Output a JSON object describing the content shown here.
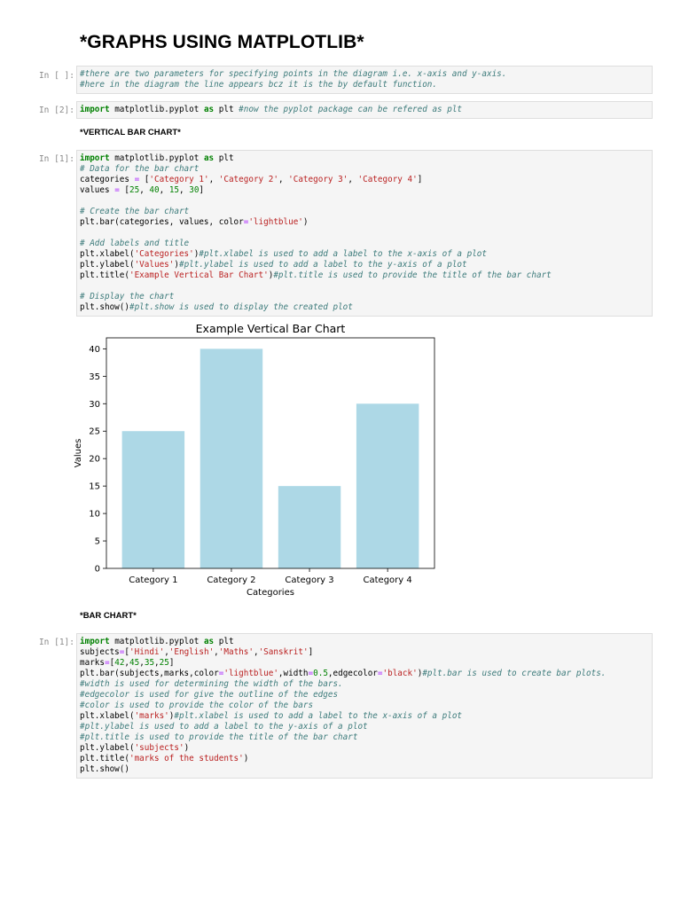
{
  "page": {
    "title": "*GRAPHS USING MATPLOTLIB*"
  },
  "cells": {
    "c1": {
      "prompt": "In [ ]:",
      "lines": [
        [
          {
            "t": "#there are two parameters for specifying points in the diagram i.e. x-axis and y-axis.",
            "c": "cm"
          }
        ],
        [
          {
            "t": "#here in the diagram the line appears bcz it is the by default function.",
            "c": "cm"
          }
        ]
      ]
    },
    "c2": {
      "prompt": "In [2]:",
      "lines": [
        [
          {
            "t": "import",
            "c": "kw"
          },
          {
            "t": " matplotlib.pyplot ",
            "c": ""
          },
          {
            "t": "as",
            "c": "kw"
          },
          {
            "t": " plt ",
            "c": ""
          },
          {
            "t": "#now the pyplot package can be refered as plt",
            "c": "cm"
          }
        ]
      ]
    },
    "md1": {
      "text": "*VERTICAL BAR CHART*"
    },
    "c3": {
      "prompt": "In [1]:",
      "lines": [
        [
          {
            "t": "import",
            "c": "kw"
          },
          {
            "t": " matplotlib.pyplot ",
            "c": ""
          },
          {
            "t": "as",
            "c": "kw"
          },
          {
            "t": " plt",
            "c": ""
          }
        ],
        [
          {
            "t": "# Data for the bar chart",
            "c": "cm"
          }
        ],
        [
          {
            "t": "categories ",
            "c": ""
          },
          {
            "t": "=",
            "c": "op"
          },
          {
            "t": " [",
            "c": ""
          },
          {
            "t": "'Category 1'",
            "c": "str"
          },
          {
            "t": ", ",
            "c": ""
          },
          {
            "t": "'Category 2'",
            "c": "str"
          },
          {
            "t": ", ",
            "c": ""
          },
          {
            "t": "'Category 3'",
            "c": "str"
          },
          {
            "t": ", ",
            "c": ""
          },
          {
            "t": "'Category 4'",
            "c": "str"
          },
          {
            "t": "]",
            "c": ""
          }
        ],
        [
          {
            "t": "values ",
            "c": ""
          },
          {
            "t": "=",
            "c": "op"
          },
          {
            "t": " [",
            "c": ""
          },
          {
            "t": "25",
            "c": "num"
          },
          {
            "t": ", ",
            "c": ""
          },
          {
            "t": "40",
            "c": "num"
          },
          {
            "t": ", ",
            "c": ""
          },
          {
            "t": "15",
            "c": "num"
          },
          {
            "t": ", ",
            "c": ""
          },
          {
            "t": "30",
            "c": "num"
          },
          {
            "t": "]",
            "c": ""
          }
        ],
        [],
        [
          {
            "t": "# Create the bar chart",
            "c": "cm"
          }
        ],
        [
          {
            "t": "plt.bar(categories, values, color",
            "c": ""
          },
          {
            "t": "=",
            "c": "op"
          },
          {
            "t": "'lightblue'",
            "c": "str"
          },
          {
            "t": ")",
            "c": ""
          }
        ],
        [],
        [
          {
            "t": "# Add labels and title",
            "c": "cm"
          }
        ],
        [
          {
            "t": "plt.xlabel(",
            "c": ""
          },
          {
            "t": "'Categories'",
            "c": "str"
          },
          {
            "t": ")",
            "c": ""
          },
          {
            "t": "#plt.xlabel is used to add a label to the x-axis of a plot",
            "c": "cm"
          }
        ],
        [
          {
            "t": "plt.ylabel(",
            "c": ""
          },
          {
            "t": "'Values'",
            "c": "str"
          },
          {
            "t": ")",
            "c": ""
          },
          {
            "t": "#plt.ylabel is used to add a label to the y-axis of a plot",
            "c": "cm"
          }
        ],
        [
          {
            "t": "plt.title(",
            "c": ""
          },
          {
            "t": "'Example Vertical Bar Chart'",
            "c": "str"
          },
          {
            "t": ")",
            "c": ""
          },
          {
            "t": "#plt.title is used to provide the title of the bar chart",
            "c": "cm"
          }
        ],
        [],
        [
          {
            "t": "# Display the chart",
            "c": "cm"
          }
        ],
        [
          {
            "t": "plt.show()",
            "c": ""
          },
          {
            "t": "#plt.show is used to display the created plot",
            "c": "cm"
          }
        ]
      ]
    },
    "md2": {
      "text": "*BAR CHART*"
    },
    "c4": {
      "prompt": "In [1]:",
      "lines": [
        [
          {
            "t": "import",
            "c": "kw"
          },
          {
            "t": " matplotlib.pyplot ",
            "c": ""
          },
          {
            "t": "as",
            "c": "kw"
          },
          {
            "t": " plt",
            "c": ""
          }
        ],
        [
          {
            "t": "subjects",
            "c": ""
          },
          {
            "t": "=",
            "c": "op"
          },
          {
            "t": "[",
            "c": ""
          },
          {
            "t": "'Hindi'",
            "c": "str"
          },
          {
            "t": ",",
            "c": ""
          },
          {
            "t": "'English'",
            "c": "str"
          },
          {
            "t": ",",
            "c": ""
          },
          {
            "t": "'Maths'",
            "c": "str"
          },
          {
            "t": ",",
            "c": ""
          },
          {
            "t": "'Sanskrit'",
            "c": "str"
          },
          {
            "t": "]",
            "c": ""
          }
        ],
        [
          {
            "t": "marks",
            "c": ""
          },
          {
            "t": "=",
            "c": "op"
          },
          {
            "t": "[",
            "c": ""
          },
          {
            "t": "42",
            "c": "num"
          },
          {
            "t": ",",
            "c": ""
          },
          {
            "t": "45",
            "c": "num"
          },
          {
            "t": ",",
            "c": ""
          },
          {
            "t": "35",
            "c": "num"
          },
          {
            "t": ",",
            "c": ""
          },
          {
            "t": "25",
            "c": "num"
          },
          {
            "t": "]",
            "c": ""
          }
        ],
        [
          {
            "t": "plt.bar(subjects,marks,color",
            "c": ""
          },
          {
            "t": "=",
            "c": "op"
          },
          {
            "t": "'lightblue'",
            "c": "str"
          },
          {
            "t": ",width",
            "c": ""
          },
          {
            "t": "=",
            "c": "op"
          },
          {
            "t": "0.5",
            "c": "num"
          },
          {
            "t": ",edgecolor",
            "c": ""
          },
          {
            "t": "=",
            "c": "op"
          },
          {
            "t": "'black'",
            "c": "str"
          },
          {
            "t": ")",
            "c": ""
          },
          {
            "t": "#plt.bar is used to create bar plots.",
            "c": "cm"
          }
        ],
        [
          {
            "t": "#width is used for determining the width of the bars.",
            "c": "cm"
          }
        ],
        [
          {
            "t": "#edgecolor is used for give the outline of the edges",
            "c": "cm"
          }
        ],
        [
          {
            "t": "#color is used to provide the color of the bars",
            "c": "cm"
          }
        ],
        [
          {
            "t": "plt.xlabel(",
            "c": ""
          },
          {
            "t": "'marks'",
            "c": "str"
          },
          {
            "t": ")",
            "c": ""
          },
          {
            "t": "#plt.xlabel is used to add a label to the x-axis of a plot",
            "c": "cm"
          }
        ],
        [
          {
            "t": "#plt.ylabel is used to add a label to the y-axis of a plot",
            "c": "cm"
          }
        ],
        [
          {
            "t": "#plt.title is used to provide the title of the bar chart",
            "c": "cm"
          }
        ],
        [
          {
            "t": "plt.ylabel(",
            "c": ""
          },
          {
            "t": "'subjects'",
            "c": "str"
          },
          {
            "t": ")",
            "c": ""
          }
        ],
        [
          {
            "t": "plt.title(",
            "c": ""
          },
          {
            "t": "'marks of the students'",
            "c": "str"
          },
          {
            "t": ")",
            "c": ""
          }
        ],
        [
          {
            "t": "plt.show()",
            "c": ""
          }
        ]
      ]
    }
  },
  "chart_data": {
    "type": "bar",
    "title": "Example Vertical Bar Chart",
    "xlabel": "Categories",
    "ylabel": "Values",
    "categories": [
      "Category 1",
      "Category 2",
      "Category 3",
      "Category 4"
    ],
    "values": [
      25,
      40,
      15,
      30
    ],
    "ylim": [
      0,
      42
    ],
    "yticks": [
      0,
      5,
      10,
      15,
      20,
      25,
      30,
      35,
      40
    ],
    "bar_color": "#add8e6",
    "grid": false
  },
  "colors": {
    "keyword": "#008000",
    "string": "#ba2121",
    "number": "#008000",
    "operator": "#aa22ff",
    "comment": "#3d7b7b"
  }
}
